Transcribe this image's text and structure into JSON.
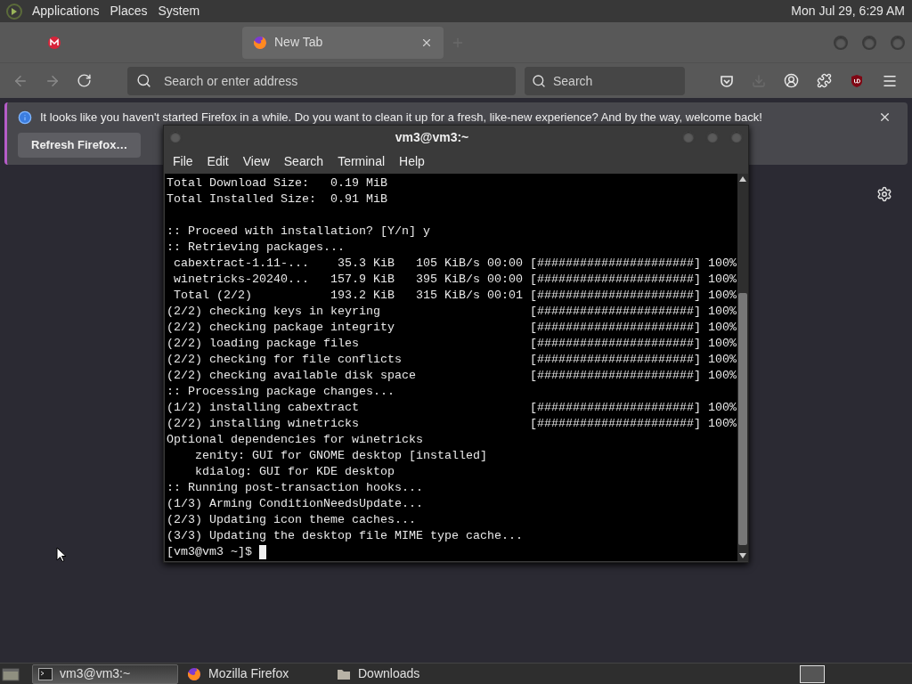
{
  "top_panel": {
    "menus": [
      "Applications",
      "Places",
      "System"
    ],
    "clock": "Mon Jul 29, 6:29 AM"
  },
  "browser": {
    "tabs": [
      {
        "kind": "mail",
        "selected": false
      },
      {
        "kind": "browser",
        "title": "New Tab",
        "selected": true
      }
    ],
    "address_placeholder": "Search or enter address",
    "search_placeholder": "Search",
    "notification": {
      "message": "It looks like you haven't started Firefox in a while. Do you want to clean it up for a fresh, like-new experience? And by the way, welcome back!",
      "button": "Refresh Firefox…"
    }
  },
  "terminal": {
    "title": "vm3@vm3:~",
    "menu": [
      "File",
      "Edit",
      "View",
      "Search",
      "Terminal",
      "Help"
    ],
    "lines": [
      {
        "kind": "text",
        "text": "Total Download Size:   0.19 MiB"
      },
      {
        "kind": "text",
        "text": "Total Installed Size:  0.91 MiB"
      },
      {
        "kind": "blank"
      },
      {
        "kind": "text",
        "text": ":: Proceed with installation? [Y/n] y"
      },
      {
        "kind": "text",
        "text": ":: Retrieving packages..."
      },
      {
        "kind": "progress",
        "text": " cabextract-1.11-...    35.3 KiB   105 KiB/s 00:00",
        "progress": "[######################] 100%"
      },
      {
        "kind": "progress",
        "text": " winetricks-20240...   157.9 KiB   395 KiB/s 00:00",
        "progress": "[######################] 100%"
      },
      {
        "kind": "progress",
        "text": " Total (2/2)           193.2 KiB   315 KiB/s 00:01",
        "progress": "[######################] 100%"
      },
      {
        "kind": "progress",
        "text": "(2/2) checking keys in keyring",
        "progress": "[######################] 100%"
      },
      {
        "kind": "progress",
        "text": "(2/2) checking package integrity",
        "progress": "[######################] 100%"
      },
      {
        "kind": "progress",
        "text": "(2/2) loading package files",
        "progress": "[######################] 100%"
      },
      {
        "kind": "progress",
        "text": "(2/2) checking for file conflicts",
        "progress": "[######################] 100%"
      },
      {
        "kind": "progress",
        "text": "(2/2) checking available disk space",
        "progress": "[######################] 100%"
      },
      {
        "kind": "text",
        "text": ":: Processing package changes..."
      },
      {
        "kind": "progress",
        "text": "(1/2) installing cabextract",
        "progress": "[######################] 100%"
      },
      {
        "kind": "progress",
        "text": "(2/2) installing winetricks",
        "progress": "[######################] 100%"
      },
      {
        "kind": "text",
        "text": "Optional dependencies for winetricks"
      },
      {
        "kind": "text",
        "text": "    zenity: GUI for GNOME desktop [installed]"
      },
      {
        "kind": "text",
        "text": "    kdialog: GUI for KDE desktop"
      },
      {
        "kind": "text",
        "text": ":: Running post-transaction hooks..."
      },
      {
        "kind": "text",
        "text": "(1/3) Arming ConditionNeedsUpdate..."
      },
      {
        "kind": "text",
        "text": "(2/3) Updating icon theme caches..."
      },
      {
        "kind": "text",
        "text": "(3/3) Updating the desktop file MIME type cache..."
      }
    ],
    "prompt": "[vm3@vm3 ~]$"
  },
  "taskbar": {
    "tasks": [
      {
        "kind": "terminal",
        "label": "vm3@vm3:~",
        "selected": true
      },
      {
        "kind": "browser",
        "label": "Mozilla Firefox",
        "selected": false
      },
      {
        "kind": "folder",
        "label": "Downloads",
        "selected": false
      }
    ]
  }
}
